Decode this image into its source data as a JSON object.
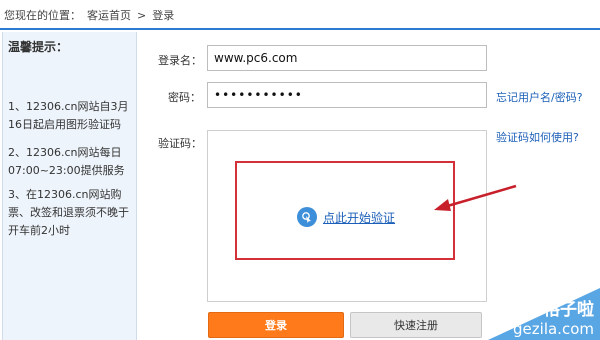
{
  "breadcrumb": {
    "prefix": "您现在的位置：",
    "home": "客运首页",
    "separator": ">",
    "current": "登录"
  },
  "tips": {
    "title": "温馨提示：",
    "items": [
      "1、12306.cn网站自3月16日起启用图形验证码",
      "2、12306.cn网站每日07:00~23:00提供服务",
      "3、在12306.cn网站购票、改签和退票须不晚于开车前2小时"
    ]
  },
  "form": {
    "username_label": "登录名：",
    "username_value": "www.pc6.com",
    "password_label": "密码：",
    "password_value": "•••••••••••",
    "forgot_link": "忘记用户名/密码?",
    "captcha_label": "验证码：",
    "captcha_help_link": "验证码如何使用?",
    "captcha_action": "点此开始验证",
    "login_button": "登录",
    "register_button": "快速注册"
  },
  "watermark": {
    "line1": "格子啦",
    "line2": "gezila.com"
  },
  "colors": {
    "accent_blue": "#2b7bd0",
    "link": "#1c5fb8",
    "login_orange": "#ff7a1a",
    "highlight_red": "#d4303a"
  }
}
